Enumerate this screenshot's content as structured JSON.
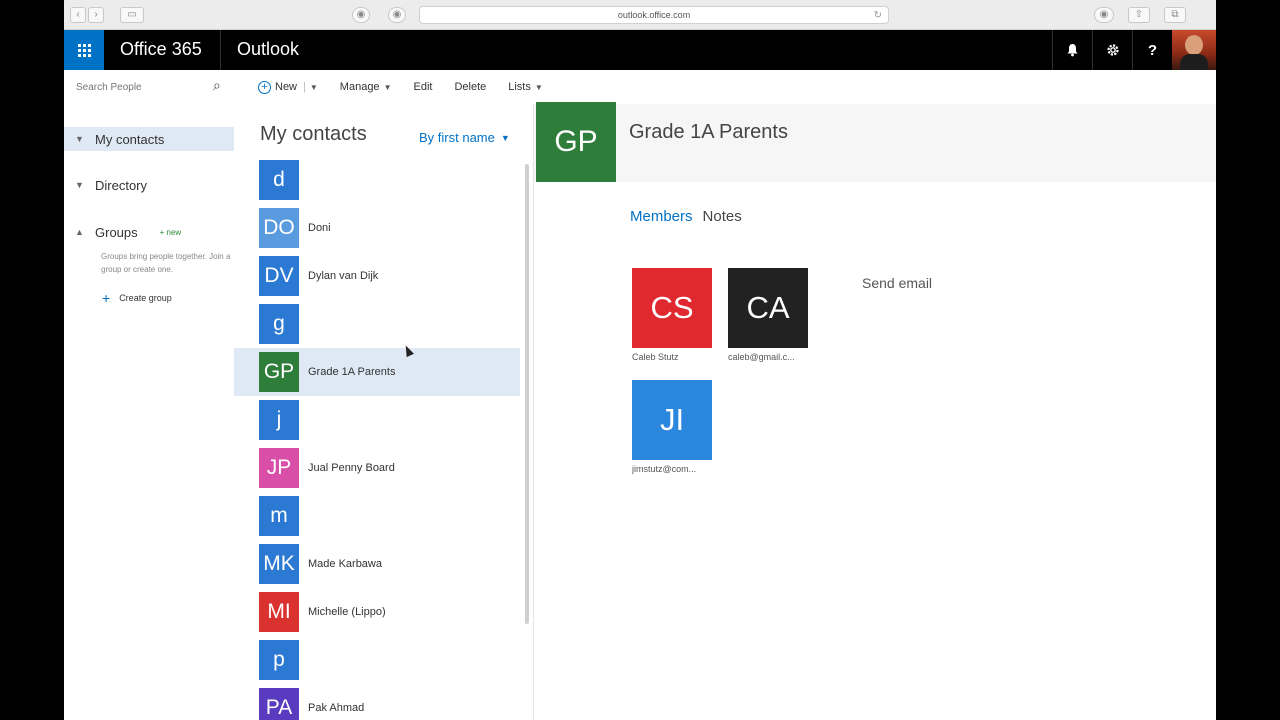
{
  "browser": {
    "url": "outlook.office.com"
  },
  "suite": {
    "brand": "Office 365",
    "app": "Outlook",
    "icons": [
      "bell-icon",
      "gear-icon",
      "help-icon"
    ]
  },
  "search": {
    "placeholder": "Search People"
  },
  "toolbar": {
    "new_label": "New",
    "manage_label": "Manage",
    "edit_label": "Edit",
    "delete_label": "Delete",
    "lists_label": "Lists"
  },
  "nav": {
    "my_contacts": "My contacts",
    "directory": "Directory",
    "groups": "Groups",
    "groups_new": "+ new",
    "groups_description": "Groups bring people together. Join a group or create one.",
    "create_group": "Create group"
  },
  "list": {
    "title": "My contacts",
    "sort_label": "By first name",
    "contacts": [
      {
        "initials": "d",
        "name": "",
        "color": "#2b79d3"
      },
      {
        "initials": "DO",
        "name": "Doni",
        "color": "#5a9be0"
      },
      {
        "initials": "DV",
        "name": "Dylan van Dijk",
        "color": "#2b79d3"
      },
      {
        "initials": "g",
        "name": "",
        "color": "#2b79d3"
      },
      {
        "initials": "GP",
        "name": "Grade 1A Parents",
        "color": "#2e7d3a"
      },
      {
        "initials": "j",
        "name": "",
        "color": "#2b79d3"
      },
      {
        "initials": "JP",
        "name": "Jual Penny Board",
        "color": "#d94fa8"
      },
      {
        "initials": "m",
        "name": "",
        "color": "#2b79d3"
      },
      {
        "initials": "MK",
        "name": "Made Karbawa",
        "color": "#2b79d3"
      },
      {
        "initials": "MI",
        "name": "Michelle (Lippo)",
        "color": "#d9322f"
      },
      {
        "initials": "p",
        "name": "",
        "color": "#2b79d3"
      },
      {
        "initials": "PA",
        "name": "Pak Ahmad",
        "color": "#5a3bbf"
      }
    ],
    "selected_index": 4
  },
  "group": {
    "initials": "GP",
    "title": "Grade 1A Parents",
    "tab_members": "Members",
    "tab_notes": "Notes",
    "send_email": "Send email",
    "members": [
      {
        "initials": "CS",
        "name": "Caleb Stutz",
        "color": "#e0282f"
      },
      {
        "initials": "CA",
        "name": "caleb@gmail.c...",
        "color": "#222222"
      },
      {
        "initials": "JI",
        "name": "jimstutz@com...",
        "color": "#2b86de"
      }
    ]
  }
}
